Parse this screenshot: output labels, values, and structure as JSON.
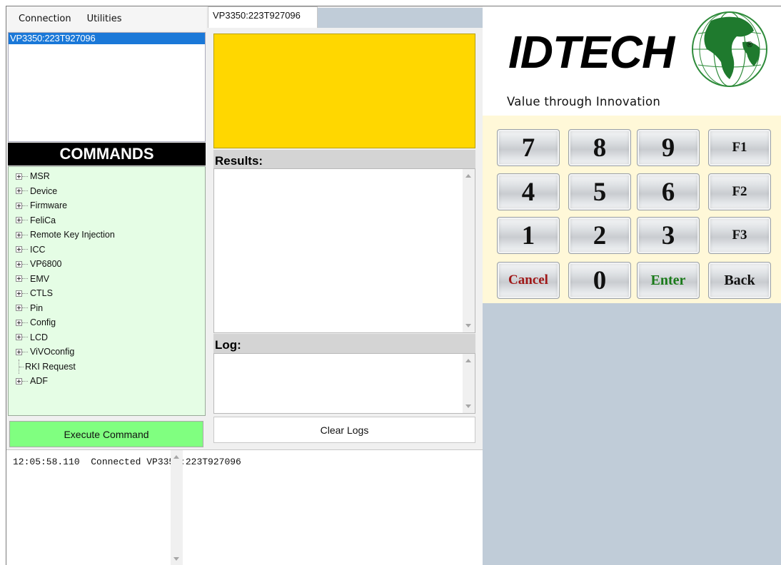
{
  "menu": {
    "items": [
      "Connection",
      "Utilities"
    ]
  },
  "devices": {
    "items": [
      "VP3350:223T927096"
    ]
  },
  "commands": {
    "header": "COMMANDS",
    "tree": [
      {
        "label": "MSR",
        "expandable": true
      },
      {
        "label": "Device",
        "expandable": true
      },
      {
        "label": "Firmware",
        "expandable": true
      },
      {
        "label": "FeliCa",
        "expandable": true
      },
      {
        "label": "Remote Key Injection",
        "expandable": true
      },
      {
        "label": "ICC",
        "expandable": true
      },
      {
        "label": "VP6800",
        "expandable": true
      },
      {
        "label": "EMV",
        "expandable": true
      },
      {
        "label": "CTLS",
        "expandable": true
      },
      {
        "label": "Pin",
        "expandable": true
      },
      {
        "label": "Config",
        "expandable": true
      },
      {
        "label": "LCD",
        "expandable": true
      },
      {
        "label": "ViVOconfig",
        "expandable": true
      },
      {
        "label": "RKI Request",
        "expandable": false
      },
      {
        "label": "ADF",
        "expandable": true
      }
    ],
    "execute_label": "Execute Command"
  },
  "tab": {
    "label": "VP3350:223T927096"
  },
  "status": {
    "color": "#ffd700"
  },
  "results": {
    "label": "Results:",
    "content": ""
  },
  "log": {
    "label": "Log:",
    "content": "",
    "clear_label": "Clear Logs"
  },
  "console": {
    "lines": [
      "12:05:58.110  Connected VP3350:223T927096"
    ]
  },
  "brand": {
    "logo": "IDTECH",
    "tagline": "Value through Innovation",
    "accent": "#2e8b3a"
  },
  "keypad": {
    "keys": [
      {
        "label": "7",
        "kind": "digit"
      },
      {
        "label": "8",
        "kind": "digit"
      },
      {
        "label": "9",
        "kind": "digit"
      },
      {
        "label": "F1",
        "kind": "fn"
      },
      {
        "label": "4",
        "kind": "digit"
      },
      {
        "label": "5",
        "kind": "digit"
      },
      {
        "label": "6",
        "kind": "digit"
      },
      {
        "label": "F2",
        "kind": "fn"
      },
      {
        "label": "1",
        "kind": "digit"
      },
      {
        "label": "2",
        "kind": "digit"
      },
      {
        "label": "3",
        "kind": "digit"
      },
      {
        "label": "F3",
        "kind": "fn"
      },
      {
        "label": "Cancel",
        "kind": "cancel"
      },
      {
        "label": "0",
        "kind": "digit"
      },
      {
        "label": "Enter",
        "kind": "enter"
      },
      {
        "label": "Back",
        "kind": "word"
      }
    ],
    "cancel_color": "#a01818",
    "enter_color": "#1a7a1a"
  }
}
